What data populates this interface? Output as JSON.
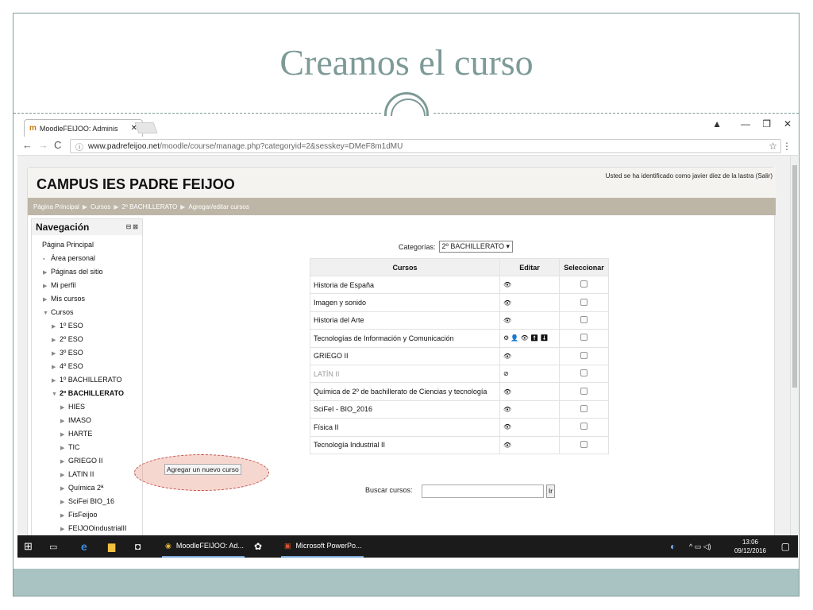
{
  "slide": {
    "title": "Creamos el curso"
  },
  "browser": {
    "tab_title": "MoodleFEIJOO: Adminis",
    "url_host": "www.padrefeijoo.net",
    "url_path": "/moodle/course/manage.php?categoryid=2&sesskey=DMeF8m1dMU"
  },
  "moodle": {
    "site_title": "CAMPUS IES PADRE FEIJOO",
    "login_info": "Usted se ha identificado como javier diez de la lastra (Salir)",
    "breadcrumb": [
      "Página Principal",
      "Cursos",
      "2º BACHILLERATO",
      "Agregar/editar cursos"
    ],
    "nav": {
      "title": "Navegación",
      "items": [
        {
          "label": "Página Principal",
          "indent": 0,
          "marker": ""
        },
        {
          "label": "Área personal",
          "indent": 1,
          "marker": "▪"
        },
        {
          "label": "Páginas del sitio",
          "indent": 1,
          "marker": "▶"
        },
        {
          "label": "Mi perfil",
          "indent": 1,
          "marker": "▶"
        },
        {
          "label": "Mis cursos",
          "indent": 1,
          "marker": "▶"
        },
        {
          "label": "Cursos",
          "indent": 1,
          "marker": "▼"
        },
        {
          "label": "1º ESO",
          "indent": 2,
          "marker": "▶"
        },
        {
          "label": "2º ESO",
          "indent": 2,
          "marker": "▶"
        },
        {
          "label": "3º ESO",
          "indent": 2,
          "marker": "▶"
        },
        {
          "label": "4º ESO",
          "indent": 2,
          "marker": "▶"
        },
        {
          "label": "1º BACHILLERATO",
          "indent": 2,
          "marker": "▶"
        },
        {
          "label": "2º BACHILLERATO",
          "indent": 2,
          "marker": "▼",
          "bold": true
        },
        {
          "label": "HIES",
          "indent": 3,
          "marker": "▶"
        },
        {
          "label": "IMASO",
          "indent": 3,
          "marker": "▶"
        },
        {
          "label": "HARTE",
          "indent": 3,
          "marker": "▶"
        },
        {
          "label": "TIC",
          "indent": 3,
          "marker": "▶"
        },
        {
          "label": "GRIEGO II",
          "indent": 3,
          "marker": "▶"
        },
        {
          "label": "LATIN II",
          "indent": 3,
          "marker": "▶"
        },
        {
          "label": "Química 2ª",
          "indent": 3,
          "marker": "▶"
        },
        {
          "label": "SciFei BIO_16",
          "indent": 3,
          "marker": "▶"
        },
        {
          "label": "FisFeijoo",
          "indent": 3,
          "marker": "▶"
        },
        {
          "label": "FEIJOOindustrialII",
          "indent": 3,
          "marker": "▶"
        }
      ]
    },
    "categories_label": "Categorías:",
    "categories_value": "2º BACHILLERATO ▾",
    "table": {
      "headers": [
        "Cursos",
        "Editar",
        "Seleccionar"
      ],
      "rows": [
        {
          "course": "Historia de España",
          "edit": "👁",
          "dim": false
        },
        {
          "course": "Imagen y sonido",
          "edit": "👁",
          "dim": false
        },
        {
          "course": "Historia del Arte",
          "edit": "👁",
          "dim": false
        },
        {
          "course": "Tecnologías de Información y Comunicación",
          "edit": "⚙ 👤 👁 ⬆ ⬇",
          "dim": false
        },
        {
          "course": "GRIEGO II",
          "edit": "👁",
          "dim": false
        },
        {
          "course": "LATÍN II",
          "edit": "⊘",
          "dim": true
        },
        {
          "course": "Química de 2º de bachillerato de Ciencias y tecnología",
          "edit": "👁",
          "dim": false
        },
        {
          "course": "SciFeI - BIO_2016",
          "edit": "👁",
          "dim": false
        },
        {
          "course": "Física II",
          "edit": "👁",
          "dim": false
        },
        {
          "course": "Tecnología Industrial II",
          "edit": "👁",
          "dim": false
        }
      ]
    },
    "add_course_button": "Agregar un nuevo curso",
    "search_label": "Buscar cursos:",
    "search_button": "Ir"
  },
  "taskbar": {
    "apps": [
      "MoodleFEIJOO: Ad...",
      "Microsoft PowerPo..."
    ],
    "time": "13:06",
    "date": "09/12/2016"
  }
}
